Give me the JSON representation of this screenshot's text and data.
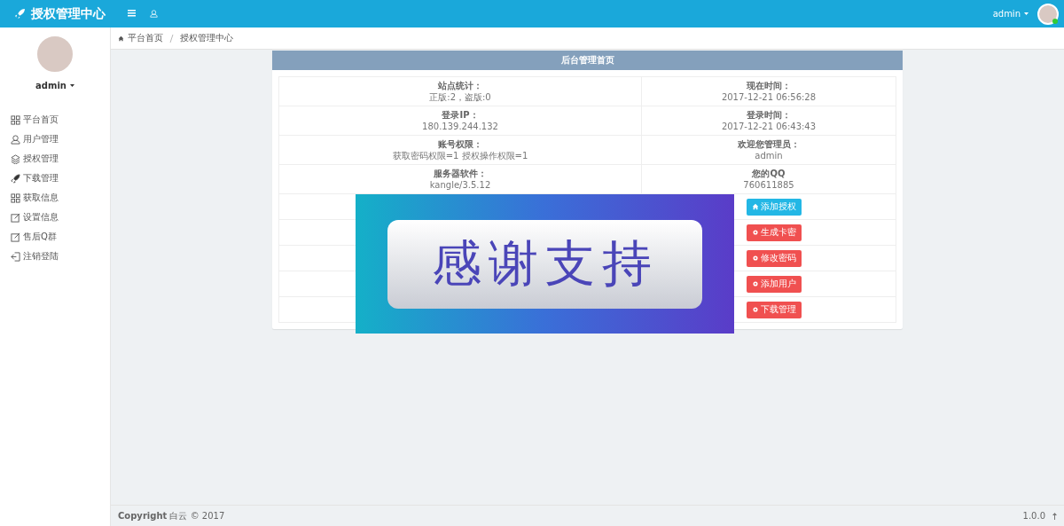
{
  "header": {
    "brand": "授权管理中心",
    "user": "admin"
  },
  "sidebar": {
    "user": "admin",
    "items": [
      {
        "label": "平台首页"
      },
      {
        "label": "用户管理"
      },
      {
        "label": "授权管理"
      },
      {
        "label": "下载管理"
      },
      {
        "label": "获取信息"
      },
      {
        "label": "设置信息"
      },
      {
        "label": "售后Q群"
      },
      {
        "label": "注销登陆"
      }
    ]
  },
  "breadcrumb": [
    "平台首页",
    "授权管理中心"
  ],
  "panel": {
    "title": "后台管理首页",
    "info_rows": [
      [
        {
          "label": "站点统计：",
          "value": "正版:2，盗版:0"
        },
        {
          "label": "现在时间：",
          "value": "2017-12-21 06:56:28"
        }
      ],
      [
        {
          "label": "登录IP：",
          "value": "180.139.244.132"
        },
        {
          "label": "登录时间：",
          "value": "2017-12-21 06:43:43"
        }
      ],
      [
        {
          "label": "账号权限：",
          "value": "获取密码权限=1 授权操作权限=1"
        },
        {
          "label": "欢迎您管理员：",
          "value": "admin"
        }
      ],
      [
        {
          "label": "服务器软件：",
          "value": "kangle/3.5.12"
        },
        {
          "label": "您的QQ",
          "value": "760611885"
        }
      ]
    ],
    "buttons": [
      {
        "label": "添加授权",
        "kind": "info"
      },
      {
        "label": "生成卡密",
        "kind": "danger"
      },
      {
        "label": "修改密码",
        "kind": "danger"
      },
      {
        "label": "添加用户",
        "kind": "danger"
      },
      {
        "label": "下载管理",
        "kind": "danger"
      }
    ],
    "overlay_banner": {
      "text": "感谢支持"
    }
  },
  "footer": {
    "copyright": "**Copyright** 白云 © 2017",
    "version": "1.0.0"
  }
}
